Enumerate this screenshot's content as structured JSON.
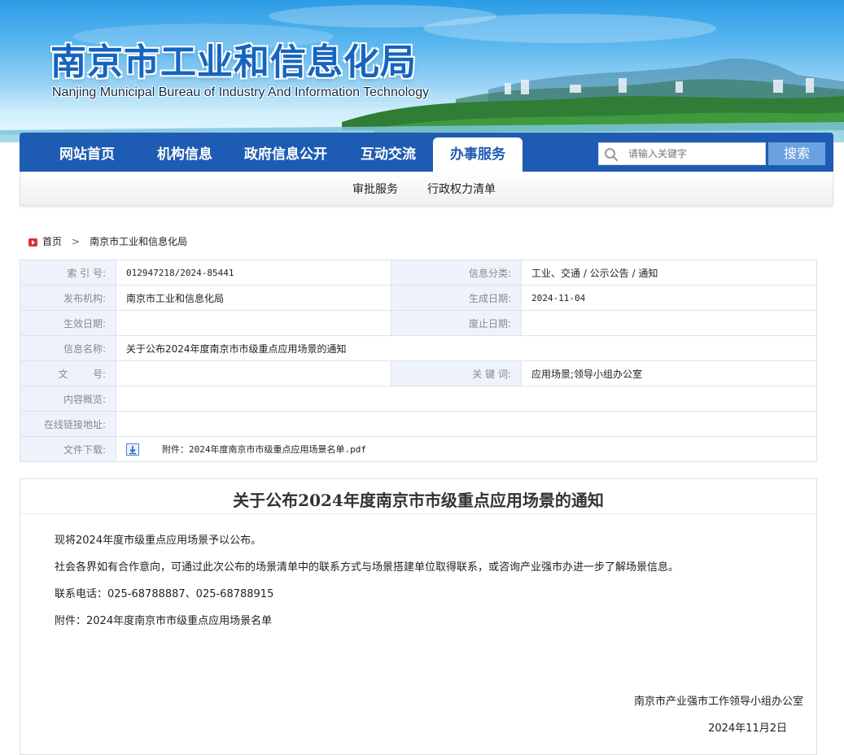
{
  "header": {
    "title": "南京市工业和信息化局",
    "subtitle": "Nanjing Municipal Bureau of Industry And Information Technology"
  },
  "nav": {
    "items": [
      "网站首页",
      "机构信息",
      "政府信息公开",
      "互动交流",
      "办事服务"
    ],
    "active_index": 4,
    "search_placeholder": "请输入关键字",
    "search_button": "搜索",
    "subnav": [
      "审批服务",
      "行政权力清单"
    ]
  },
  "breadcrumb": [
    "首页",
    "南京市工业和信息化局"
  ],
  "meta": {
    "index_label": "索 引 号:",
    "index_value": "012947218/2024-85441",
    "category_label": "信息分类:",
    "category_value": "工业、交通 / 公示公告 / 通知",
    "publisher_label": "发布机构:",
    "publisher_value": "南京市工业和信息化局",
    "created_label": "生成日期:",
    "created_value": "2024-11-04",
    "effective_label": "生效日期:",
    "effective_value": "",
    "expiry_label": "废止日期:",
    "expiry_value": "",
    "name_label": "信息名称:",
    "name_value": "关于公布2024年度南京市市级重点应用场景的通知",
    "docno_label": "文        号:",
    "docno_value": "",
    "keywords_label": "关 键 词:",
    "keywords_value": "应用场景;领导小组办公室",
    "overview_label": "内容概览:",
    "overview_value": "",
    "link_label": "在线链接地址:",
    "link_value": "",
    "download_label": "文件下载:",
    "download_value": "附件：2024年度南京市市级重点应用场景名单.pdf"
  },
  "article": {
    "title": "关于公布2024年度南京市市级重点应用场景的通知",
    "paragraphs": [
      "现将2024年度市级重点应用场景予以公布。",
      "社会各界如有合作意向，可通过此次公布的场景清单中的联系方式与场景搭建单位取得联系，或咨询产业强市办进一步了解场景信息。",
      "联系电话：025-68788887、025-68788915",
      "附件：2024年度南京市市级重点应用场景名单"
    ],
    "signature": "南京市产业强市工作领导小组办公室",
    "date": "2024年11月2日"
  },
  "colors": {
    "nav_blue": "#1e5cb3",
    "label_bg": "#eef3fb",
    "breadcrumb_icon": "#d8302c"
  }
}
